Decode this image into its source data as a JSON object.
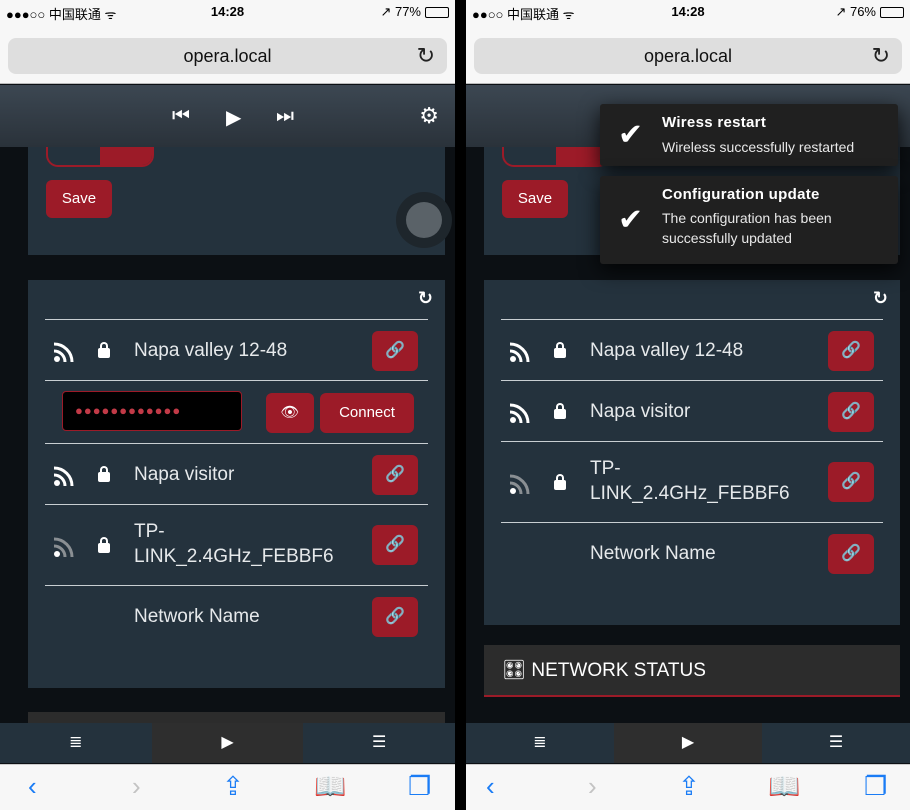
{
  "left": {
    "status": {
      "carrier": "●●●○○ 中国联通 ᯤ",
      "time": "14:28",
      "battery": "↗ 77%",
      "battery_level": 0.77
    },
    "url": "opera.local",
    "reload_icon": "↻",
    "player": {
      "prev": "⏮",
      "play": "▶",
      "next": "⏭",
      "settings": "⚙"
    },
    "save_label": "Save",
    "refresh_icon": "↻",
    "networks": [
      {
        "ssid": "Napa valley 12-48",
        "signal": "strong",
        "locked": true
      },
      {
        "ssid": "Napa visitor",
        "signal": "strong",
        "locked": true
      },
      {
        "ssid": "TP-LINK_2.4GHz_FEBBF6",
        "signal": "weak",
        "locked": true
      },
      {
        "ssid": "Network Name",
        "signal": "none",
        "locked": false
      }
    ],
    "password_value": "●●●●●●●●●●●●",
    "show_password_icon": "👁",
    "connect_label": "Connect",
    "link_icon": "🔗",
    "tabs": [
      "≣",
      "▶",
      "☰"
    ],
    "toolbar": {
      "back": "‹",
      "forward": "›",
      "share": "⇪",
      "bookmarks": "📖",
      "tabs": "❐"
    }
  },
  "right": {
    "status": {
      "carrier": "●●○○ 中国联通 ᯤ",
      "time": "14:28",
      "battery": "↗ 76%",
      "battery_level": 0.76
    },
    "url": "opera.local",
    "reload_icon": "↻",
    "save_label": "Save",
    "refresh_icon": "↻",
    "toasts": [
      {
        "title": "Wiress restart",
        "message": "Wireless successfully restarted"
      },
      {
        "title": "Configuration update",
        "message": "The configuration has been successfully updated"
      }
    ],
    "networks": [
      {
        "ssid": "Napa valley 12-48",
        "signal": "strong",
        "locked": true
      },
      {
        "ssid": "Napa visitor",
        "signal": "strong",
        "locked": true
      },
      {
        "ssid": "TP-LINK_2.4GHz_FEBBF6",
        "signal": "weak",
        "locked": true
      },
      {
        "ssid": "Network Name",
        "signal": "none",
        "locked": false
      }
    ],
    "network_status_title": "NETWORK STATUS",
    "network_status_icon": "🎛",
    "tabs": [
      "≣",
      "▶",
      "☰"
    ],
    "toolbar": {
      "back": "‹",
      "forward": "›",
      "share": "⇪",
      "bookmarks": "📖",
      "tabs": "❐"
    }
  },
  "colors": {
    "accent": "#9c1b28",
    "panel": "#24323d",
    "header": "#2a323a"
  }
}
